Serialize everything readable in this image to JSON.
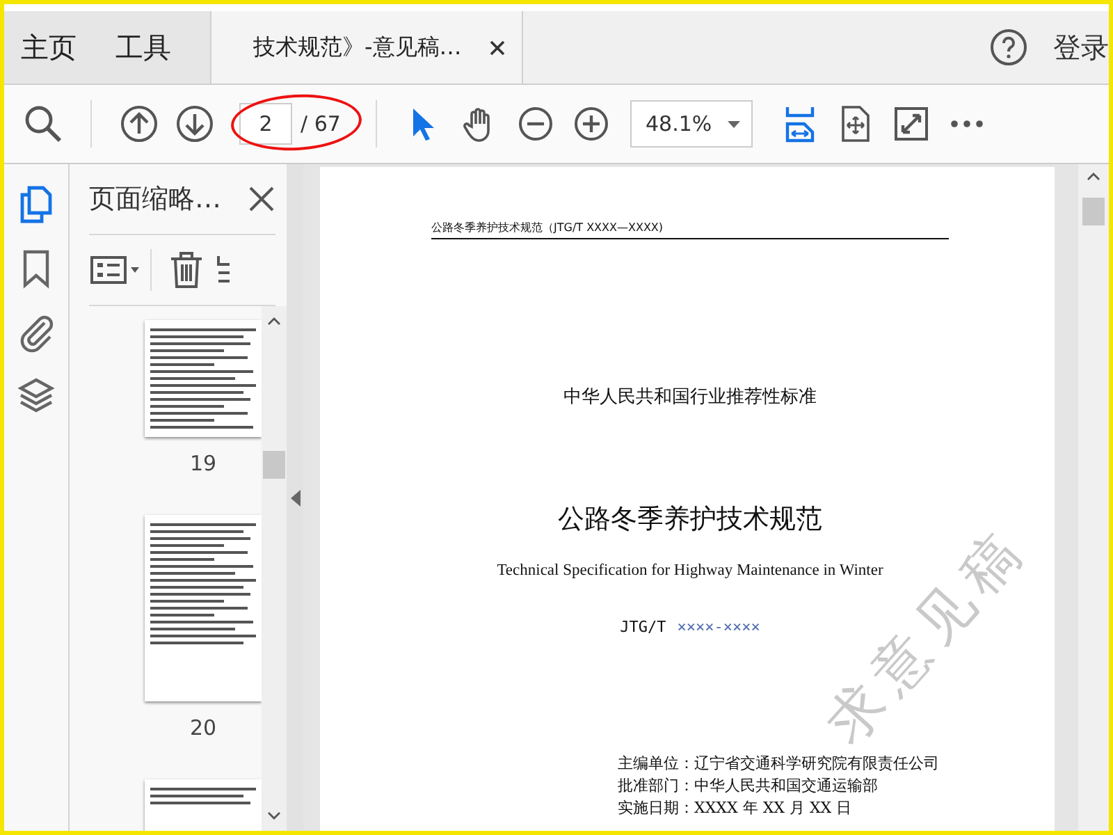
{
  "top_tabs": [
    {
      "label": "主页",
      "selected": false
    },
    {
      "label": "工具",
      "selected": false
    }
  ],
  "document_tab": {
    "label": "技术规范》-意见稿…"
  },
  "login": "登录",
  "toolbar": {
    "page_current": "2",
    "page_total": "/ 67",
    "zoom": "48.1%"
  },
  "tools": [
    {
      "kind": "select",
      "selected": true
    },
    {
      "kind": "hand",
      "selected": false
    },
    {
      "kind": "zoom-out",
      "selected": false
    },
    {
      "kind": "zoom-in",
      "selected": false
    }
  ],
  "view_tools": [
    {
      "kind": "fit-width",
      "selected": true
    },
    {
      "kind": "fit-page",
      "selected": false
    },
    {
      "kind": "fullscreen",
      "selected": false
    },
    {
      "kind": "more",
      "selected": false
    }
  ],
  "side_rail": [
    {
      "kind": "pages",
      "selected": true
    },
    {
      "kind": "bookmarks",
      "selected": false
    },
    {
      "kind": "attachments",
      "selected": false
    },
    {
      "kind": "layers",
      "selected": false
    }
  ],
  "thumbnail_panel": {
    "title": "页面缩略…",
    "thumbnails": [
      {
        "label": "19"
      },
      {
        "label": "20"
      }
    ]
  },
  "document": {
    "running_header": "公路冬季养护技术规范（JTG/T XXXX—XXXX)",
    "category": "中华人民共和国行业推荐性标准",
    "title": "公路冬季养护技术规范",
    "title_en": "Technical Specification for Highway Maintenance in Winter",
    "code": "JTG/T",
    "code_number": "××××-××××",
    "info_lines": [
      {
        "label": "主编单位：",
        "value": "辽宁省交通科学研究院有限责任公司"
      },
      {
        "label": "批准部门：",
        "value": "中华人民共和国交通运输部"
      },
      {
        "label": "实施日期：",
        "value": "XXXX 年 XX 月 XX 日"
      }
    ],
    "watermark": "求意见稿"
  }
}
